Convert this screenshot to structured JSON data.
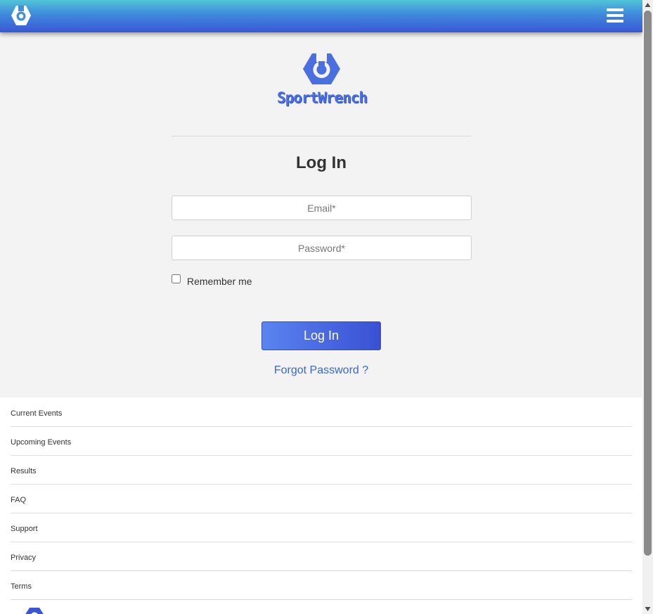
{
  "header": {
    "logo_icon": "sportwrench-logo-icon",
    "menu_icon": "hamburger-menu-icon"
  },
  "brand": {
    "name": "SportWrench",
    "color": "#4a6fe0"
  },
  "login": {
    "title": "Log In",
    "email_placeholder": "Email*",
    "password_placeholder": "Password*",
    "remember_label": "Remember me",
    "submit_label": "Log In",
    "forgot_label": "Forgot Password ?"
  },
  "footer": {
    "items": [
      {
        "label": "Current Events"
      },
      {
        "label": "Upcoming Events"
      },
      {
        "label": "Results"
      },
      {
        "label": "FAQ"
      },
      {
        "label": "Support"
      },
      {
        "label": "Privacy"
      },
      {
        "label": "Terms"
      }
    ]
  },
  "colors": {
    "accent": "#3a56d6",
    "header_top": "#50c3d6",
    "link": "#3a66d6",
    "background": "#f3f3f3"
  }
}
